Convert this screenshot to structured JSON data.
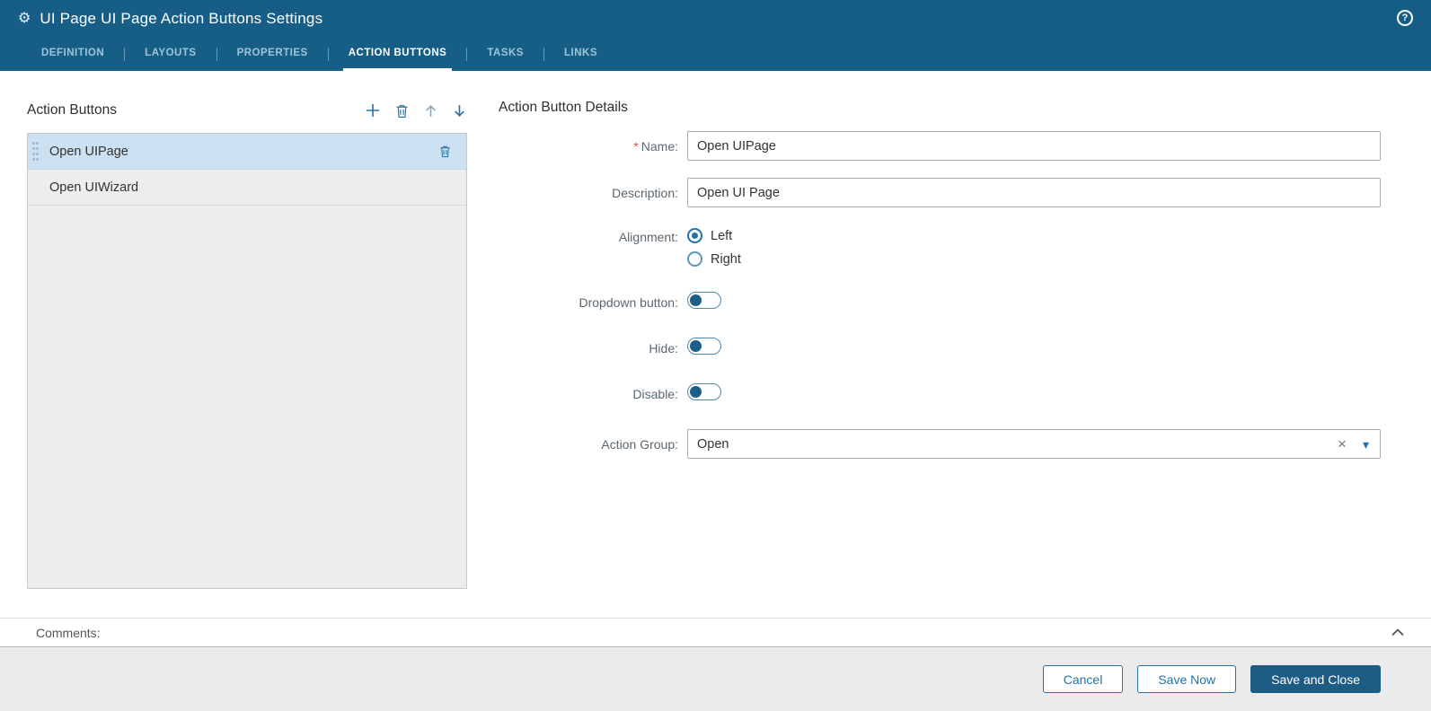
{
  "header": {
    "title": "UI Page UI Page Action Buttons Settings",
    "tabs": [
      {
        "label": "DEFINITION",
        "active": false
      },
      {
        "label": "LAYOUTS",
        "active": false
      },
      {
        "label": "PROPERTIES",
        "active": false
      },
      {
        "label": "ACTION BUTTONS",
        "active": true
      },
      {
        "label": "TASKS",
        "active": false
      },
      {
        "label": "LINKS",
        "active": false
      }
    ]
  },
  "icons": {
    "gear": "⚙",
    "help": "?",
    "clear": "×",
    "caret": "▾"
  },
  "action_buttons_panel": {
    "title": "Action Buttons",
    "items": [
      {
        "label": "Open UIPage",
        "selected": true
      },
      {
        "label": "Open UIWizard",
        "selected": false
      }
    ]
  },
  "details": {
    "title": "Action Button Details",
    "fields": {
      "name": {
        "label": "Name:",
        "required_mark": "*",
        "value": "Open UIPage"
      },
      "description": {
        "label": "Description:",
        "value": "Open UI Page"
      },
      "alignment": {
        "label": "Alignment:",
        "options": [
          {
            "label": "Left",
            "selected": true
          },
          {
            "label": "Right",
            "selected": false
          }
        ]
      },
      "dropdown_button": {
        "label": "Dropdown button:",
        "value": false
      },
      "hide": {
        "label": "Hide:",
        "value": false
      },
      "disable": {
        "label": "Disable:",
        "value": false
      },
      "action_group": {
        "label": "Action Group:",
        "value": "Open"
      }
    }
  },
  "comments": {
    "label": "Comments:"
  },
  "footer": {
    "buttons": [
      {
        "label": "Cancel",
        "style": "secondary"
      },
      {
        "label": "Save Now",
        "style": "secondary"
      },
      {
        "label": "Save and Close",
        "style": "primary"
      }
    ]
  },
  "colors": {
    "header_bg": "#175e86",
    "accent": "#2272a8",
    "primary_btn_bg": "#1d5c85",
    "selected_row_bg": "#cbe0f1",
    "list_bg": "#ededed",
    "required": "#d9534f",
    "toggle_knob": "#1b5f88"
  }
}
